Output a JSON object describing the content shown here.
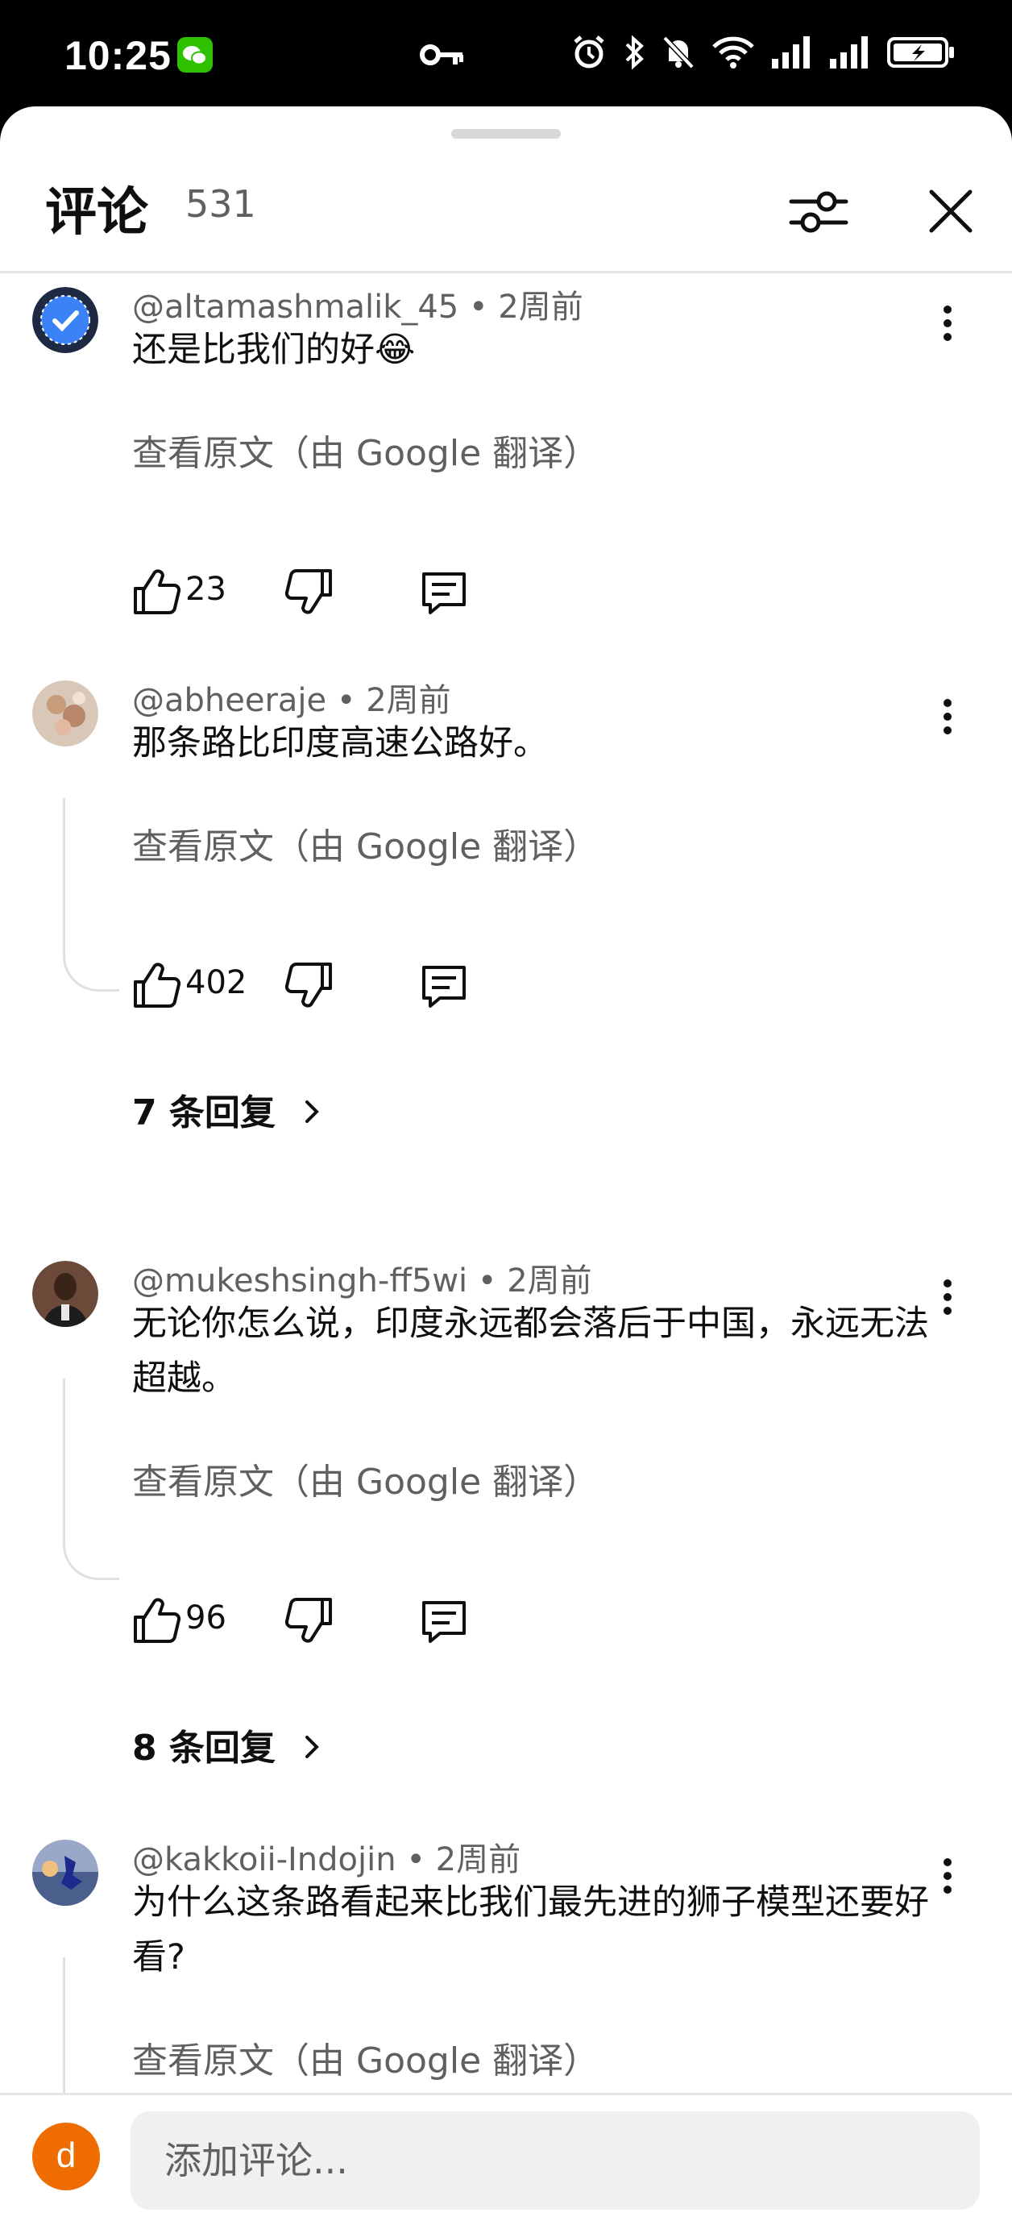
{
  "status_bar": {
    "time": "10:25"
  },
  "header": {
    "title": "评论",
    "count": "531"
  },
  "comments": [
    {
      "author": "@altamashmalik_45",
      "age": "2周前",
      "text": "还是比我们的好😂",
      "translate_label": "查看原文（由 Google 翻译）",
      "likes": "23"
    },
    {
      "author": "@abheeraje",
      "age": "2周前",
      "text": "那条路比印度高速公路好。",
      "translate_label": "查看原文（由 Google 翻译）",
      "likes": "402",
      "replies": "7 条回复"
    },
    {
      "author": "@mukeshsingh-ff5wi",
      "age": "2周前",
      "text": "无论你怎么说，印度永远都会落后于中国，永远无法超越。",
      "translate_label": "查看原文（由 Google 翻译）",
      "likes": "96",
      "replies": "8 条回复"
    },
    {
      "author": "@kakkoii-Indojin",
      "age": "2周前",
      "text": "为什么这条路看起来比我们最先进的狮子模型还要好看?",
      "translate_label": "查看原文（由 Google 翻译）"
    }
  ],
  "composer": {
    "avatar_letter": "d",
    "placeholder": "添加评论..."
  },
  "colors": {
    "primary_text": "#0f0f0f",
    "secondary_text": "#606060",
    "avatar_orange": "#ef6c00"
  }
}
